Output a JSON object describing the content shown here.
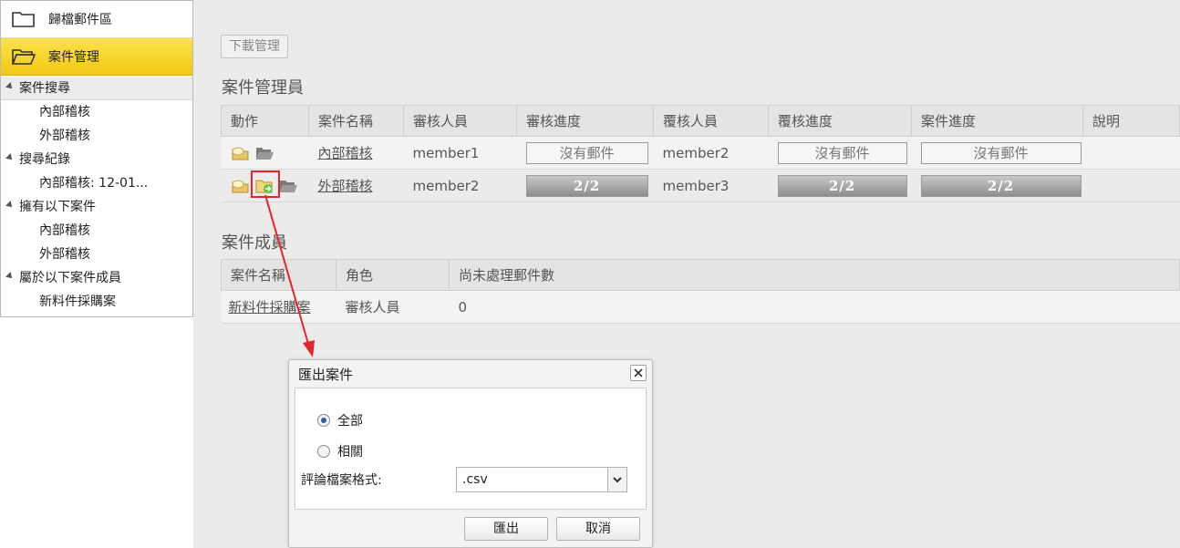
{
  "sidebar": {
    "archive_label": "歸檔郵件區",
    "case_mgmt_label": "案件管理",
    "tree": [
      {
        "kind": "head",
        "label": "案件搜尋"
      },
      {
        "kind": "child",
        "label": "內部稽核"
      },
      {
        "kind": "child",
        "label": "外部稽核"
      },
      {
        "kind": "head",
        "label": "搜尋紀錄"
      },
      {
        "kind": "child",
        "label": "內部稽核: 12-01..."
      },
      {
        "kind": "head",
        "label": "擁有以下案件"
      },
      {
        "kind": "child",
        "label": "內部稽核"
      },
      {
        "kind": "child",
        "label": "外部稽核"
      },
      {
        "kind": "head",
        "label": "屬於以下案件成員"
      },
      {
        "kind": "child",
        "label": "新料件採購案"
      }
    ]
  },
  "main": {
    "download_button": "下載管理",
    "admin_title": "案件管理員",
    "admin_table": {
      "headers": [
        "動作",
        "案件名稱",
        "審核人員",
        "審核進度",
        "覆核人員",
        "覆核進度",
        "案件進度",
        "說明"
      ],
      "rows": [
        {
          "name": "內部稽核",
          "reviewer": "member1",
          "review_progress": "沒有郵件",
          "rereviewer": "member2",
          "rereview_progress": "沒有郵件",
          "case_progress": "沒有郵件",
          "note": ""
        },
        {
          "name": "外部稽核",
          "reviewer": "member2",
          "review_progress": "2/2",
          "rereviewer": "member3",
          "rereview_progress": "2/2",
          "case_progress": "2/2",
          "note": ""
        }
      ]
    },
    "member_title": "案件成員",
    "member_table": {
      "headers": [
        "案件名稱",
        "角色",
        "尚未處理郵件數"
      ],
      "rows": [
        {
          "name": "新料件採購案",
          "role": "審核人員",
          "pending": "0"
        }
      ]
    }
  },
  "dialog": {
    "title": "匯出案件",
    "option_all": "全部",
    "option_related": "相關",
    "format_label": "評論檔案格式:",
    "format_value": ".csv",
    "export_button": "匯出",
    "cancel_button": "取消"
  },
  "colors": {
    "accent_yellow": "#f2c814",
    "highlight_red": "#e4242b"
  }
}
